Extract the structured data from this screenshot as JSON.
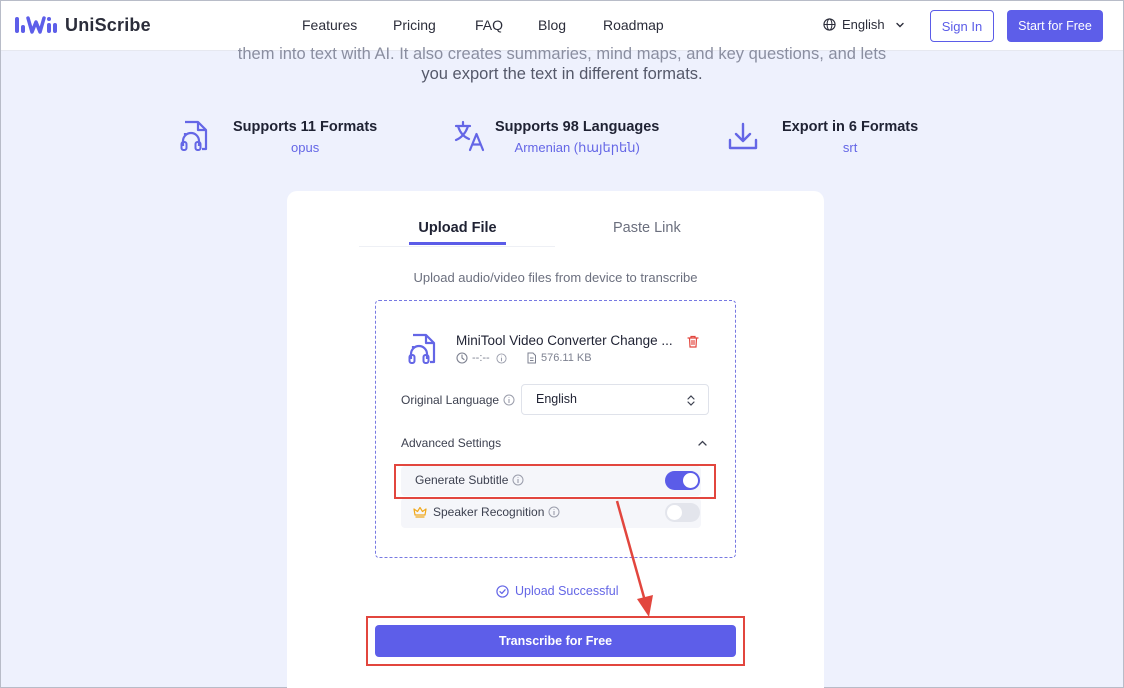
{
  "header": {
    "brand": "UniScribe",
    "nav": [
      "Features",
      "Pricing",
      "FAQ",
      "Blog",
      "Roadmap"
    ],
    "language": "English",
    "sign_in": "Sign In",
    "start": "Start for Free"
  },
  "intro": {
    "line1": "them into text with AI. It also creates summaries, mind maps, and key questions, and lets",
    "line2": "you export the text in different formats."
  },
  "features": [
    {
      "title": "Supports 11 Formats",
      "sub": "opus",
      "icon": "audio-file-icon"
    },
    {
      "title": "Supports 98 Languages",
      "sub": "Armenian (հայերեն)",
      "icon": "translate-icon"
    },
    {
      "title": "Export in 6 Formats",
      "sub": "srt",
      "icon": "download-icon"
    }
  ],
  "tabs": {
    "upload": "Upload File",
    "paste": "Paste Link"
  },
  "upload_hint": "Upload audio/video files from device to transcribe",
  "file": {
    "name": "MiniTool Video Converter Change ...",
    "duration": "--:--",
    "size": "576.11 KB"
  },
  "settings": {
    "original_language_label": "Original Language",
    "original_language_value": "English",
    "advanced_label": "Advanced Settings",
    "generate_subtitle_label": "Generate Subtitle",
    "generate_subtitle_on": true,
    "speaker_recognition_label": "Speaker Recognition",
    "speaker_recognition_on": false
  },
  "status": "Upload Successful",
  "transcribe_button": "Transcribe for Free",
  "colors": {
    "accent": "#5d5ee9",
    "highlight": "#e2463e",
    "background": "#eef1fd"
  }
}
